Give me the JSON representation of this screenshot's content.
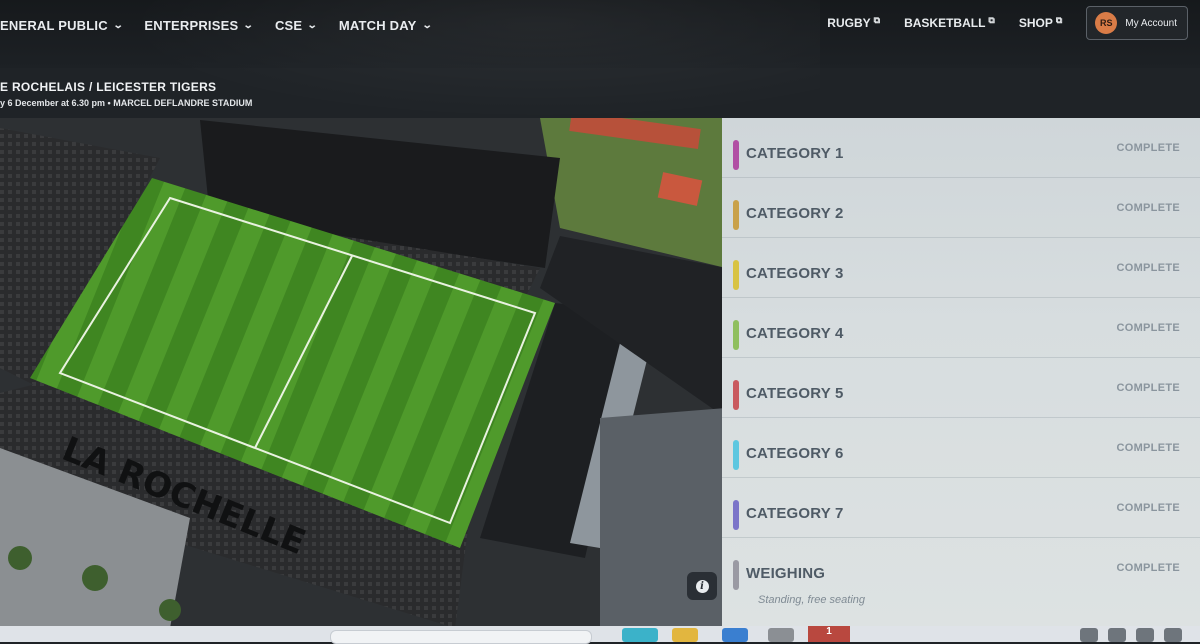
{
  "nav": {
    "left_items": [
      {
        "label": "ENERAL PUBLIC"
      },
      {
        "label": "ENTERPRISES"
      },
      {
        "label": "CSE"
      },
      {
        "label": "MATCH DAY"
      }
    ],
    "right_links": [
      {
        "label": "RUGBY",
        "icon": "external-link-icon"
      },
      {
        "label": "BASKETBALL",
        "icon": "external-link-icon"
      },
      {
        "label": "SHOP",
        "icon": "external-link-icon"
      }
    ],
    "account": {
      "initials": "RS",
      "label": "My Account",
      "avatar_color": "#d97c47"
    }
  },
  "match": {
    "title": "E ROCHELAIS / LEICESTER TIGERS",
    "subtitle": "y 6 December at 6.30 pm  •  MARCEL DEFLANDRE STADIUM"
  },
  "stadium": {
    "lettering": "LA ROCHELLE"
  },
  "categories": [
    {
      "label": "CATEGORY 1",
      "status": "COMPLETE",
      "color": "#b14fa4"
    },
    {
      "label": "CATEGORY 2",
      "status": "COMPLETE",
      "color": "#c9a14a"
    },
    {
      "label": "CATEGORY 3",
      "status": "COMPLETE",
      "color": "#d8c343"
    },
    {
      "label": "CATEGORY 4",
      "status": "COMPLETE",
      "color": "#8fbf5e"
    },
    {
      "label": "CATEGORY 5",
      "status": "COMPLETE",
      "color": "#c95a5f"
    },
    {
      "label": "CATEGORY 6",
      "status": "COMPLETE",
      "color": "#5ec7e0"
    },
    {
      "label": "CATEGORY 7",
      "status": "COMPLETE",
      "color": "#7b74c9"
    },
    {
      "label": "WEIGHING",
      "status": "COMPLETE",
      "color": "#9a9aa3",
      "note": "Standing, free seating"
    }
  ],
  "taskbar": {
    "badge": "1"
  }
}
